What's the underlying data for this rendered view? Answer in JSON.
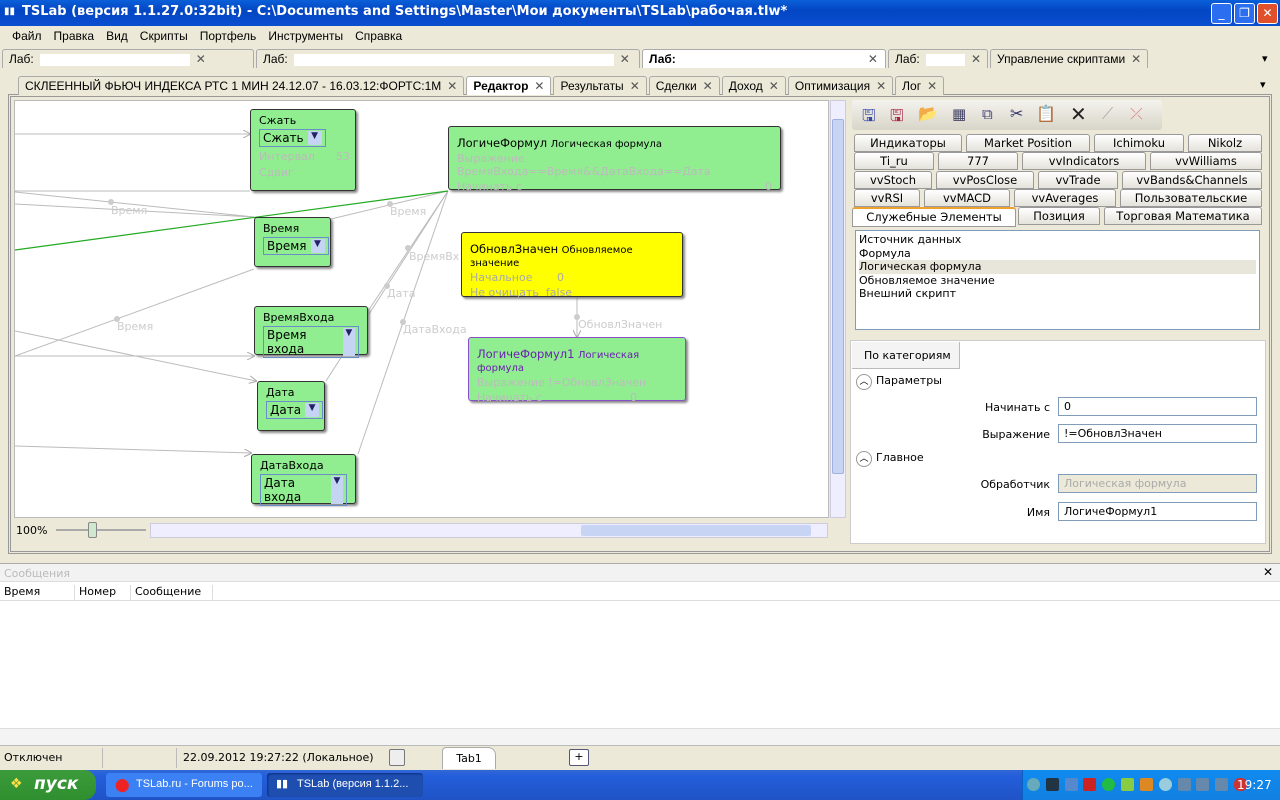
{
  "window": {
    "title": "TSLab (версия 1.1.27.0:32bit) - C:\\Documents and Settings\\Master\\Мои документы\\TSLab\\рабочая.tlw*",
    "min": "_",
    "max": "❐",
    "close": "✕"
  },
  "menu": [
    "Файл",
    "Правка",
    "Вид",
    "Скрипты",
    "Портфель",
    "Инструменты",
    "Справка"
  ],
  "lab_tabs": [
    {
      "label": "Лаб:"
    },
    {
      "label": "Лаб:"
    },
    {
      "label": "Лаб:"
    },
    {
      "label": "Лаб:"
    },
    {
      "label": "Управление скриптами"
    }
  ],
  "inner_tabs": [
    "СКЛЕЕННЫЙ ФЬЮЧ ИНДЕКСА РТС 1 МИН 24.12.07 - 16.03.12:ФОРТС:1М",
    "Редактор",
    "Результаты",
    "Сделки",
    "Доход",
    "Оптимизация",
    "Лог"
  ],
  "close_glyph": "✕",
  "nodes": {
    "compress": {
      "title": "Сжать",
      "select": "Сжать",
      "p1": "Интервал",
      "v1": "53",
      "p2": "Сдвиг"
    },
    "time": {
      "title": "Время",
      "select": "Время"
    },
    "entry_time": {
      "title": "ВремяВхода",
      "select": "Время входа"
    },
    "date": {
      "title": "Дата",
      "select": "Дата"
    },
    "entry_date": {
      "title": "ДатаВхода",
      "select": "Дата входа"
    },
    "logic": {
      "title": "ЛогичеФормул",
      "type": "Логическая формула",
      "p1": "Выражение ВремяВхода==Время&&ДатаВхода==Дата",
      "p2": "Начинать с",
      "v2": "0"
    },
    "update": {
      "title": "ОбновлЗначен",
      "type": "Обновляемое значение",
      "p1": "Начальное",
      "v1": "0",
      "p2": "Не очищать",
      "v2": "false"
    },
    "logic1": {
      "title": "ЛогичеФормул1",
      "type": "Логическая формула",
      "p1": "Выражение !=ОбновлЗначен",
      "p2": "Начинать с",
      "v2": "0"
    }
  },
  "edge_labels": [
    "Время",
    "Время",
    "Время",
    "ВремяВх",
    "Дата",
    "ДатаВхода",
    "ОбновлЗначен"
  ],
  "zoom": {
    "level": "100%",
    "slider": 0.5
  },
  "palette_tabs": [
    "Индикаторы",
    "Market Position",
    "Ichimoku",
    "Nikolz",
    "Ti_ru",
    "777",
    "vvIndicators",
    "vvWilliams",
    "vvStoch",
    "vvPosClose",
    "vvTrade",
    "vvBands&Channels",
    "vvRSI",
    "vvMACD",
    "vvAverages",
    "Пользовательские",
    "Служебные Элементы",
    "Позиция",
    "Торговая Математика"
  ],
  "palette_items": [
    "Источник данных",
    "Формула",
    "Логическая формула",
    "Обновляемое значение",
    "Внешний скрипт"
  ],
  "props": {
    "tab": "По категориям",
    "cat1": "Параметры",
    "start_label": "Начинать с",
    "start_value": "0",
    "expr_label": "Выражение",
    "expr_value": "!=ОбновлЗначен",
    "cat2": "Главное",
    "handler_label": "Обработчик",
    "handler_value": "Логическая формула",
    "name_label": "Имя",
    "name_value": "ЛогичеФормул1"
  },
  "messages": {
    "title": "Сообщения",
    "columns": [
      "Время",
      "Номер",
      "Сообщение"
    ]
  },
  "status": {
    "connection": "Отключен",
    "datetime": "22.09.2012 19:27:22 (Локальное)",
    "tab": "Tab1",
    "add": "+"
  },
  "taskbar": {
    "start": "пуск",
    "tasks": [
      "TSLab.ru - Forums po...",
      "TSLab (версия 1.1.2..."
    ],
    "clock": "19:27"
  }
}
